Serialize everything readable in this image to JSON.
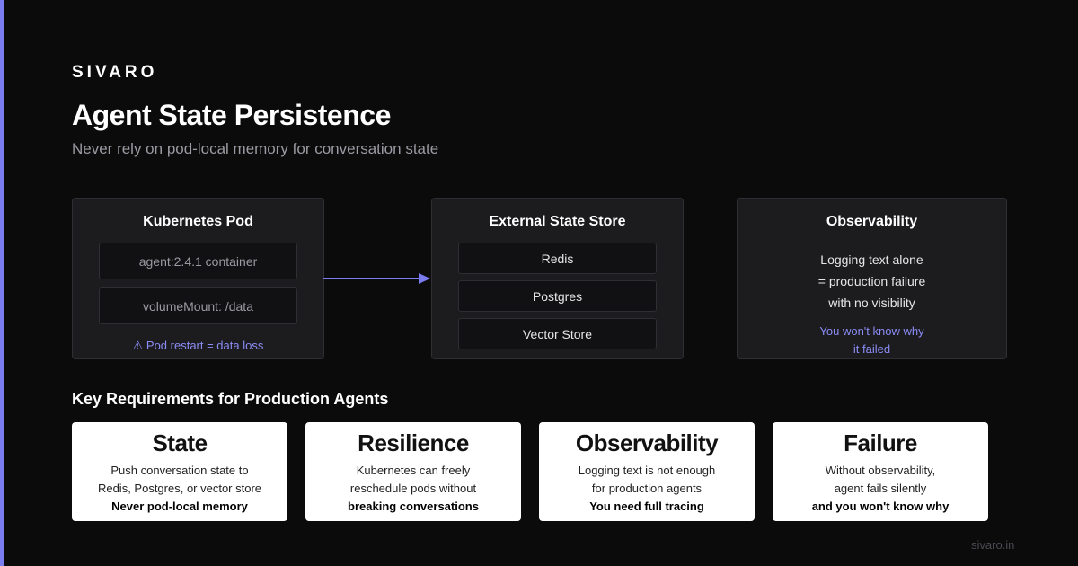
{
  "brand": "SIVARO",
  "title": "Agent State Persistence",
  "subtitle": "Never rely on pod-local memory for conversation state",
  "accent_color": "#7b7cf0",
  "pod": {
    "title": "Kubernetes Pod",
    "items": [
      "agent:2.4.1 container",
      "volumeMount: /data"
    ],
    "warning": "⚠ Pod restart = data loss"
  },
  "store": {
    "title": "External State Store",
    "items": [
      "Redis",
      "Postgres",
      "Vector Store"
    ]
  },
  "observability": {
    "title": "Observability",
    "lines": [
      "Logging text alone",
      "= production failure",
      "with no visibility"
    ],
    "note_lines": [
      "You won't know why",
      "it failed"
    ]
  },
  "requirements": {
    "heading": "Key Requirements for Production Agents",
    "cards": [
      {
        "title": "State",
        "lines": [
          "Push conversation state to",
          "Redis, Postgres, or vector store"
        ],
        "emphasis": "Never pod-local memory"
      },
      {
        "title": "Resilience",
        "lines": [
          "Kubernetes can freely",
          "reschedule pods without"
        ],
        "emphasis": "breaking conversations"
      },
      {
        "title": "Observability",
        "lines": [
          "Logging text is not enough",
          "for production agents"
        ],
        "emphasis": "You need full tracing"
      },
      {
        "title": "Failure",
        "lines": [
          "Without observability,",
          "agent fails silently"
        ],
        "emphasis": "and you won't know why"
      }
    ]
  },
  "footer": "sivaro.in"
}
